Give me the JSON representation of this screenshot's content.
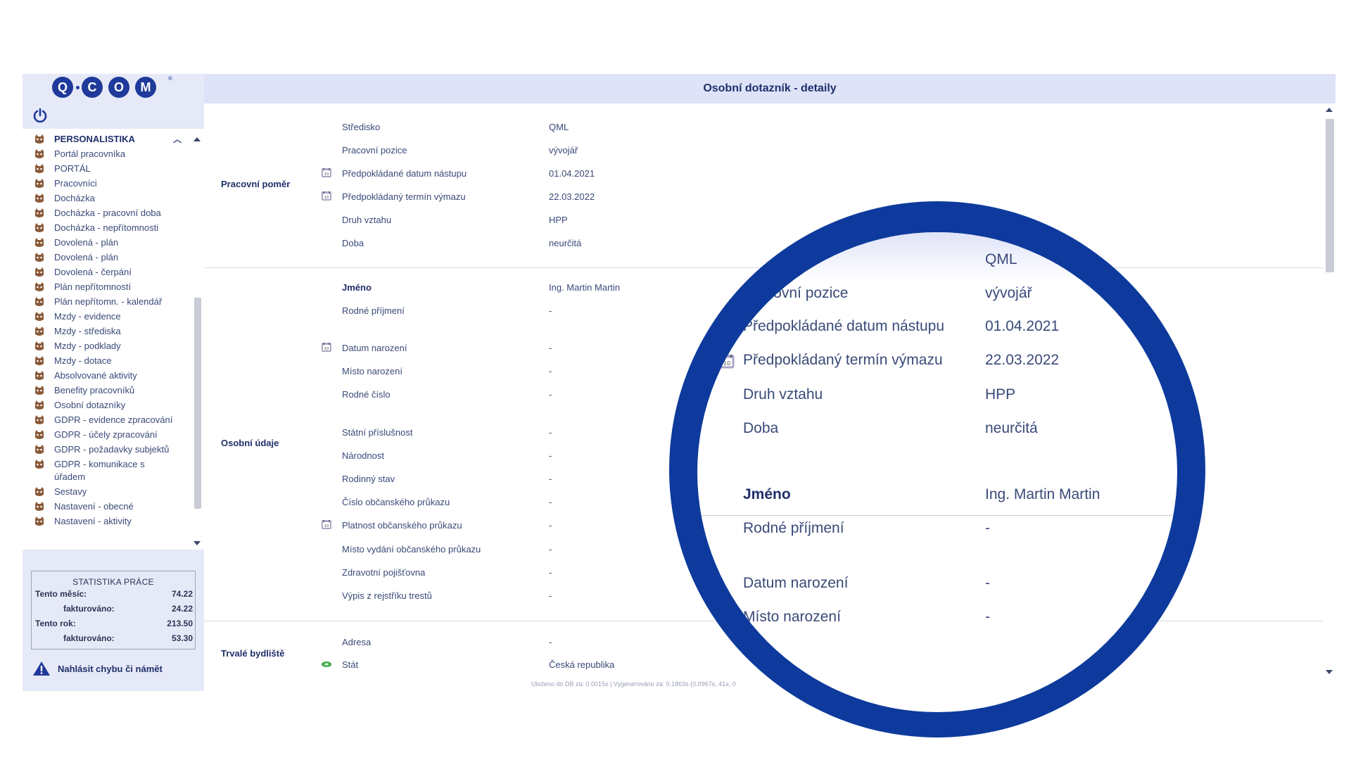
{
  "app": {
    "logo_text": "Q·COM",
    "page_title": "Osobní dotazník - detaily"
  },
  "sidebar": {
    "section_header": "PERSONALISTIKA",
    "items": [
      "Portál pracovníka",
      "PORTÁL",
      "Pracovníci",
      "Docházka",
      "Docházka - pracovní doba",
      "Docházka - nepřítomnosti",
      "Dovolená - plán",
      "Dovolená - plán",
      "Dovolená - čerpání",
      "Plán nepřítomností",
      "Plán nepřítomn. - kalendář",
      "Mzdy - evidence",
      "Mzdy - střediska",
      "Mzdy - podklady",
      "Mzdy - dotace",
      "Absolvované aktivity",
      "Benefity pracovníků",
      "Osobní dotazníky",
      "GDPR - evidence zpracování",
      "GDPR - účely zpracování",
      "GDPR - požadavky subjektů",
      "GDPR - komunikace s úřadem",
      "Sestavy",
      "Nastavení - obecné",
      "Nastavení - aktivity"
    ]
  },
  "stats": {
    "title": "STATISTIKA PRÁCE",
    "month_label": "Tento měsíc:",
    "month_value": "74.22",
    "month_billed_label": "fakturováno:",
    "month_billed_value": "24.22",
    "year_label": "Tento rok:",
    "year_value": "213.50",
    "year_billed_label": "fakturováno:",
    "year_billed_value": "53.30"
  },
  "report_link": "Nahlásit chybu či námět",
  "sections": {
    "employment": {
      "label": "Pracovní poměr",
      "fields": [
        {
          "label": "Středisko",
          "value": "QML"
        },
        {
          "label": "Pracovní pozice",
          "value": "vývojář"
        },
        {
          "label": "Předpokládané datum nástupu",
          "value": "01.04.2021"
        },
        {
          "label": "Předpokládaný termín výmazu",
          "value": "22.03.2022"
        },
        {
          "label": "Druh vztahu",
          "value": "HPP"
        },
        {
          "label": "Doba",
          "value": "neurčitá"
        }
      ]
    },
    "personal": {
      "label": "Osobní údaje",
      "fields": [
        {
          "label": "Jméno",
          "value": "Ing. Martin Martin"
        },
        {
          "label": "Rodné příjmení",
          "value": "-"
        },
        {
          "label": "Datum narození",
          "value": "-"
        },
        {
          "label": "Místo narození",
          "value": "-"
        },
        {
          "label": "Rodné číslo",
          "value": "-"
        },
        {
          "label": "Státní příslušnost",
          "value": "-"
        },
        {
          "label": "Národnost",
          "value": "-"
        },
        {
          "label": "Rodinný stav",
          "value": "-"
        },
        {
          "label": "Číslo občanského průkazu",
          "value": "-"
        },
        {
          "label": "Platnost občanského průkazu",
          "value": "-"
        },
        {
          "label": "Místo vydání občanského průkazu",
          "value": "-"
        },
        {
          "label": "Zdravotní pojišťovna",
          "value": "-"
        },
        {
          "label": "Výpis z rejstříku trestů",
          "value": "-"
        }
      ]
    },
    "residence": {
      "label": "Trvalé bydliště",
      "fields": [
        {
          "label": "Adresa",
          "value": "-"
        },
        {
          "label": "Stát",
          "value": "Česká republika"
        }
      ]
    }
  },
  "footer": "Uloženo do DB za: 0.0015s | Vygenerováno za: 0.1863s (0.0967s, 41x, 0",
  "magnifier": {
    "fields": [
      {
        "label": "Středisko",
        "value": "QML"
      },
      {
        "label": "Pracovní pozice",
        "value": "vývojář"
      },
      {
        "label": "Předpokládané datum nástupu",
        "value": "01.04.2021"
      },
      {
        "label": "Předpokládaný termín výmazu",
        "value": "22.03.2022"
      },
      {
        "label": "Druh vztahu",
        "value": "HPP"
      },
      {
        "label": "Doba",
        "value": "neurčitá"
      },
      {
        "label": "Jméno",
        "value": "Ing. Martin Martin"
      },
      {
        "label": "Rodné příjmení",
        "value": "-"
      },
      {
        "label": "Datum narození",
        "value": "-"
      },
      {
        "label": "Místo narození",
        "value": "-"
      }
    ]
  },
  "colors": {
    "brand_blue": "#1f3a9a",
    "lens_ring": "#0d3a9c",
    "sidebar_bg": "#e6e9f7",
    "titlebar_bg": "#dfe3f8"
  }
}
